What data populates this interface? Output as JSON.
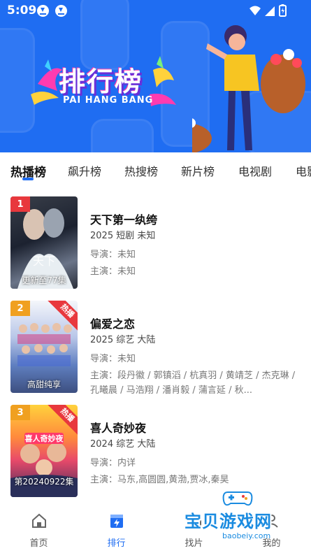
{
  "status": {
    "time": "5:09"
  },
  "banner": {
    "title": "排行榜",
    "subtitle": "PAI HANG BANG"
  },
  "tabs": [
    {
      "label": "热播榜",
      "active": true
    },
    {
      "label": "飙升榜"
    },
    {
      "label": "热搜榜"
    },
    {
      "label": "新片榜"
    },
    {
      "label": "电视剧"
    },
    {
      "label": "电影"
    }
  ],
  "items": [
    {
      "rank": "1",
      "title": "天下第一纨绔",
      "meta": "2025  短剧  未知",
      "director": "导演：未知",
      "cast": "主演：未知",
      "poster_caption": "更新至77集",
      "poster_badge": "",
      "rank_color": "#e8383d"
    },
    {
      "rank": "2",
      "title": "偏爱之恋",
      "meta": "2025  综艺  大陆",
      "director": "导演：未知",
      "cast": "主演：段丹徽 / 郭镇滔 / 杭真羽 / 黄靖芝 / 杰克琳 / 孔曦晨 / 马浩翔 / 潘肖毅 / 蒲言延 / 秋...",
      "poster_caption": "高甜纯享",
      "poster_badge": "热播",
      "rank_color": "#f0a020"
    },
    {
      "rank": "3",
      "title": "喜人奇妙夜",
      "meta": "2024  综艺  大陆",
      "director": "导演：内详",
      "cast": "主演：马东,高圆圆,黄渤,贾冰,秦昊",
      "poster_caption": "第20240922集",
      "poster_badge": "热播",
      "rank_color": "#f0a020"
    }
  ],
  "bottom_nav": [
    {
      "label": "首页",
      "icon": "home-icon"
    },
    {
      "label": "排行",
      "icon": "ranking-icon",
      "active": true
    },
    {
      "label": "找片",
      "icon": "find-icon"
    },
    {
      "label": "我的",
      "icon": "profile-icon"
    }
  ],
  "watermark": {
    "text": "宝贝游戏网",
    "url": "baobeiy.com"
  },
  "colors": {
    "accent": "#1f6df2",
    "banner": "#1f6df2",
    "rank1": "#e8383d",
    "hot": "#e8383d"
  }
}
